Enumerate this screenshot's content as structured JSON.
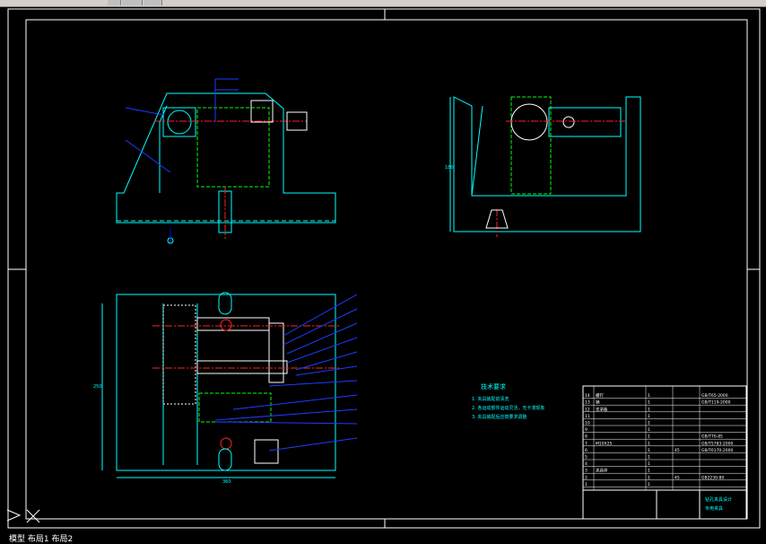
{
  "window": {
    "toolbar_buttons": [
      "tb1",
      "tb2",
      "tb3"
    ]
  },
  "drawing": {
    "tech_req_title": "技术要求",
    "tech_req_items": [
      "1. 夹具装配前清洗",
      "2. 各运动部件运动灵活，无卡滞现象",
      "3. 夹具装配后应按要求调整"
    ],
    "overall_width_dim": "360",
    "left_dim": "250",
    "side_dim": "180",
    "bom_rows": [
      {
        "no": "14",
        "name": "螺钉",
        "qty": "1",
        "mat": "",
        "std": "GB/T65-2000"
      },
      {
        "no": "13",
        "name": "销",
        "qty": "1",
        "mat": "",
        "std": "GB/T119-2000"
      },
      {
        "no": "12",
        "name": "支承板",
        "qty": "1",
        "mat": "",
        "std": ""
      },
      {
        "no": "11",
        "name": "",
        "qty": "1",
        "mat": "",
        "std": ""
      },
      {
        "no": "10",
        "name": "",
        "qty": "1",
        "mat": "",
        "std": ""
      },
      {
        "no": "9",
        "name": "",
        "qty": "1",
        "mat": "",
        "std": ""
      },
      {
        "no": "8",
        "name": "",
        "qty": "1",
        "mat": "",
        "std": "GB/T70-85"
      },
      {
        "no": "7",
        "name": "M10X25",
        "qty": "1",
        "mat": "",
        "std": "GB/T5783-2000"
      },
      {
        "no": "6",
        "name": "",
        "qty": "1",
        "mat": "45",
        "std": "GB/T6170-2000"
      },
      {
        "no": "5",
        "name": "",
        "qty": "1",
        "mat": "",
        "std": ""
      },
      {
        "no": "4",
        "name": "",
        "qty": "1",
        "mat": "",
        "std": ""
      },
      {
        "no": "3",
        "name": "夹具体",
        "qty": "1",
        "mat": "",
        "std": ""
      },
      {
        "no": "2",
        "name": "",
        "qty": "1",
        "mat": "45",
        "std": "GB2230-80"
      },
      {
        "no": "1",
        "name": "",
        "qty": "1",
        "mat": "",
        "std": ""
      }
    ],
    "title_block": {
      "title": "钻孔夹具设计",
      "subtitle": "专用夹具"
    }
  },
  "status": {
    "text": "模型 布局1 布局2"
  },
  "colors": {
    "frame": "#ffffff",
    "outline": "#00ffff",
    "center": "#ff2020",
    "part": "#00ff00",
    "hatch": "#ffffff",
    "leader": "#1e3cff"
  }
}
